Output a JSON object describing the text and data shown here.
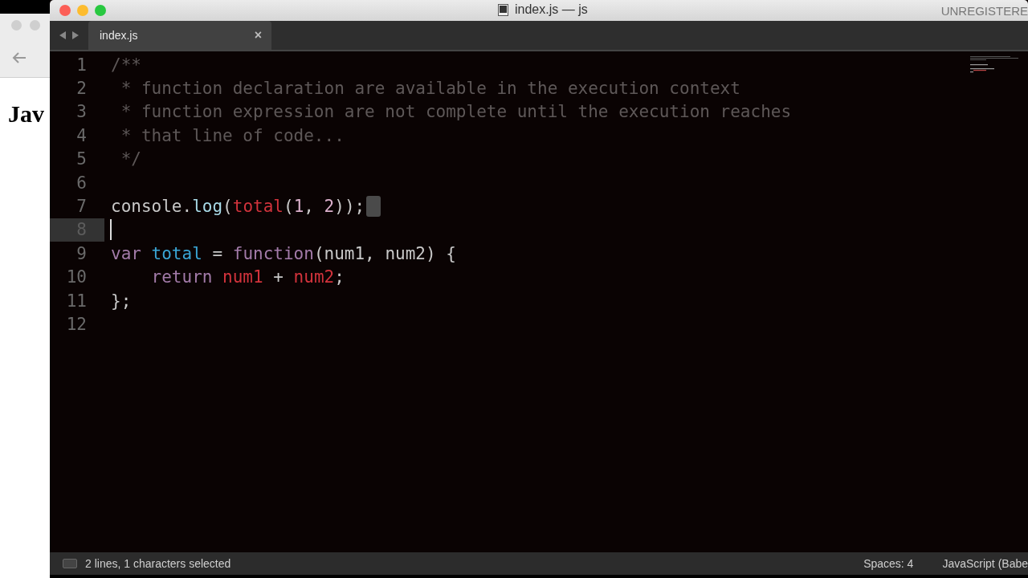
{
  "background_window": {
    "heading": "Jav"
  },
  "window": {
    "title": "index.js — js",
    "license": "UNREGISTERE"
  },
  "tabs": [
    {
      "label": "index.js",
      "selected": true,
      "close": "×"
    }
  ],
  "lines": [
    {
      "number": "1",
      "current": false,
      "newline_selected": false,
      "tokens": [
        {
          "kind": "comment",
          "text": "/**"
        }
      ]
    },
    {
      "number": "2",
      "current": false,
      "newline_selected": false,
      "tokens": [
        {
          "kind": "comment",
          "text": " * function declaration are available in the execution context"
        }
      ]
    },
    {
      "number": "3",
      "current": false,
      "newline_selected": false,
      "tokens": [
        {
          "kind": "comment",
          "text": " * function expression are not complete until the execution reaches"
        }
      ]
    },
    {
      "number": "4",
      "current": false,
      "newline_selected": false,
      "tokens": [
        {
          "kind": "comment",
          "text": " * that line of code..."
        }
      ]
    },
    {
      "number": "5",
      "current": false,
      "newline_selected": false,
      "tokens": [
        {
          "kind": "comment",
          "text": " */"
        }
      ]
    },
    {
      "number": "6",
      "current": false,
      "newline_selected": false
    },
    {
      "number": "7",
      "current": false,
      "newline_selected": true,
      "tokens": [
        {
          "kind": "plain",
          "text": "console."
        },
        {
          "kind": "method",
          "text": "log"
        },
        {
          "kind": "plain",
          "text": "("
        },
        {
          "kind": "call",
          "text": "total"
        },
        {
          "kind": "plain",
          "text": "("
        },
        {
          "kind": "number",
          "text": "1"
        },
        {
          "kind": "plain",
          "text": ", "
        },
        {
          "kind": "number",
          "text": "2"
        },
        {
          "kind": "plain",
          "text": "));"
        }
      ]
    },
    {
      "number": "8",
      "current": true,
      "newline_selected": false
    },
    {
      "number": "9",
      "current": false,
      "newline_selected": false,
      "tokens": [
        {
          "kind": "keyword",
          "text": "var"
        },
        {
          "kind": "name",
          "text": " total"
        },
        {
          "kind": "plain",
          "text": " = "
        },
        {
          "kind": "keyword",
          "text": "function"
        },
        {
          "kind": "plain",
          "text": "(num1, num2) {"
        }
      ]
    },
    {
      "number": "10",
      "current": false,
      "newline_selected": false,
      "tokens": [
        {
          "kind": "keyword",
          "text": "    return"
        },
        {
          "kind": "call",
          "text": " num1"
        },
        {
          "kind": "plain",
          "text": " + "
        },
        {
          "kind": "call",
          "text": "num2"
        },
        {
          "kind": "plain",
          "text": ";"
        }
      ]
    },
    {
      "number": "11",
      "current": false,
      "newline_selected": false,
      "tokens": [
        {
          "kind": "plain",
          "text": "};"
        }
      ]
    },
    {
      "number": "12",
      "current": false,
      "newline_selected": false
    }
  ],
  "status_bar": {
    "selection": "2 lines, 1 characters selected",
    "indentation": "Spaces: 4",
    "syntax": "JavaScript (Babe"
  }
}
